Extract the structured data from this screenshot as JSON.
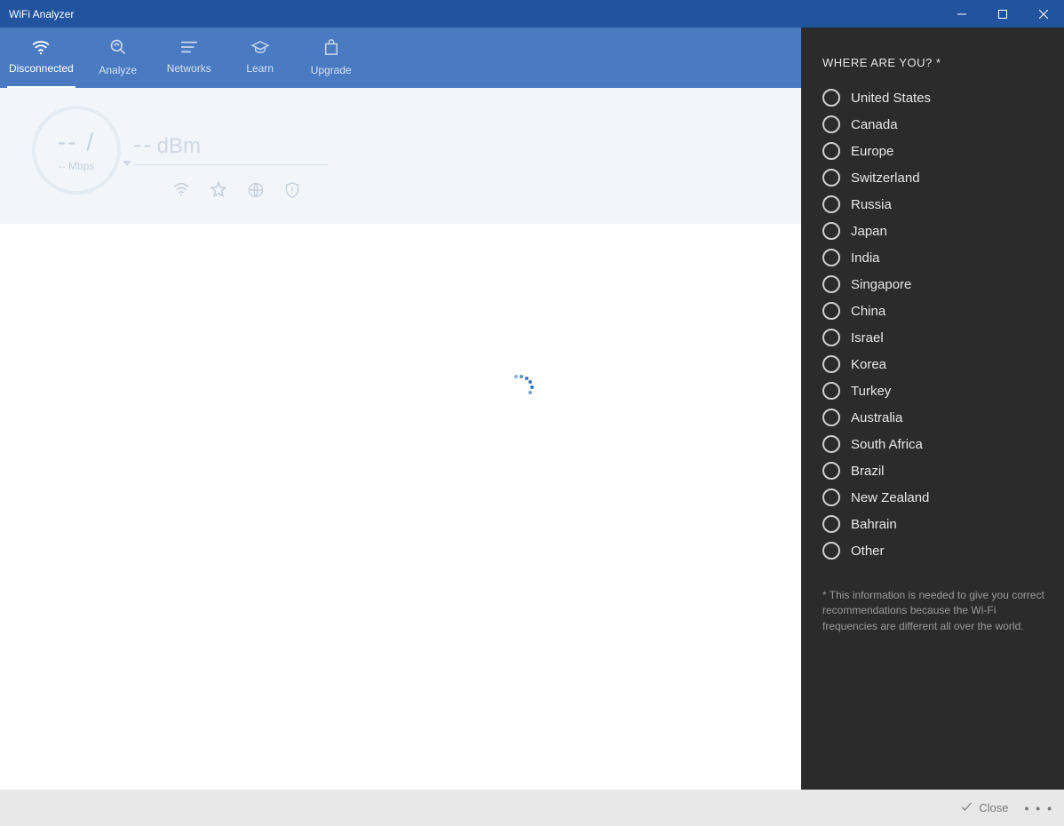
{
  "window": {
    "title": "WiFi Analyzer"
  },
  "toolbar": {
    "items": [
      {
        "label": "Disconnected"
      },
      {
        "label": "Analyze"
      },
      {
        "label": "Networks"
      },
      {
        "label": "Learn"
      },
      {
        "label": "Upgrade"
      }
    ]
  },
  "status": {
    "gauge_main": "-- /",
    "gauge_sub": "-- Mbps",
    "signal_value": "--",
    "signal_unit": "dBm"
  },
  "side_panel": {
    "heading": "WHERE ARE YOU? *",
    "options": [
      "United States",
      "Canada",
      "Europe",
      "Switzerland",
      "Russia",
      "Japan",
      "India",
      "Singapore",
      "China",
      "Israel",
      "Korea",
      "Turkey",
      "Australia",
      "South Africa",
      "Brazil",
      "New Zealand",
      "Bahrain",
      "Other"
    ],
    "note": "* This information is needed to give you correct recommendations because the Wi-Fi frequencies are different all over the world."
  },
  "bottom_bar": {
    "close_label": "Close"
  }
}
